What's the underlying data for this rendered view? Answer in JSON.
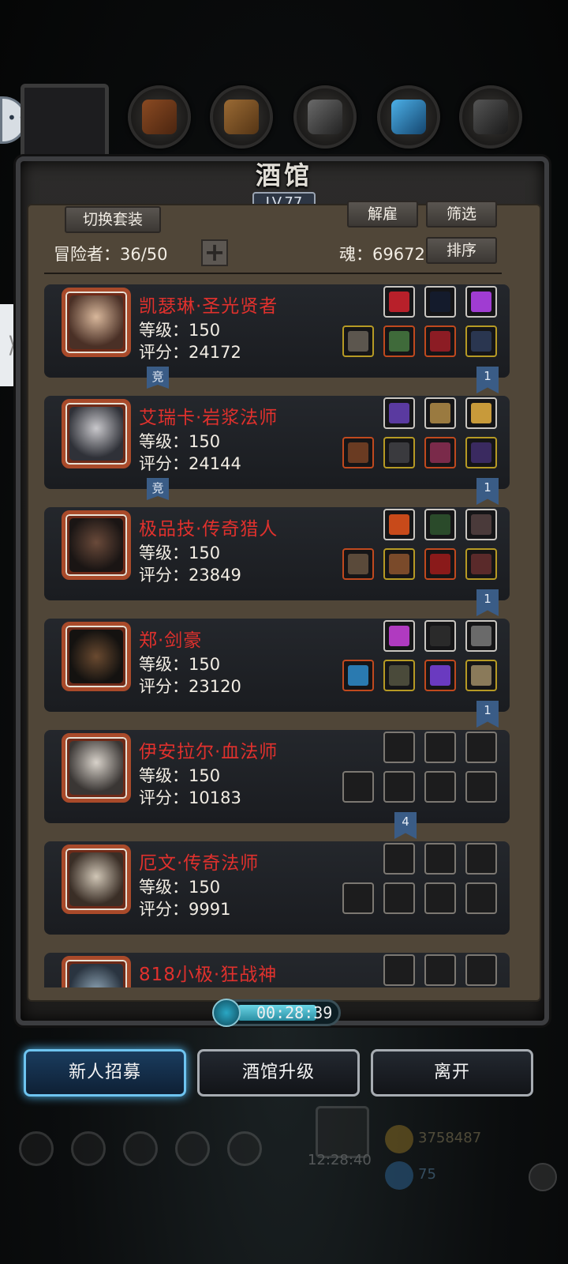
{
  "tavern": {
    "title": "酒馆",
    "level": "LV.77",
    "switch_outfit": "切换套装",
    "dismiss": "解雇",
    "filter": "筛选",
    "sort": "排序",
    "adventurers_label": "冒险者：36/50",
    "soul_label": "魂：69672",
    "plus": "+"
  },
  "heroes": [
    {
      "name": "凯瑟琳·圣光贤者",
      "level": "等级：150",
      "score": "评分：24172",
      "tag": "竞",
      "ribbon": "1"
    },
    {
      "name": "艾瑞卡·岩浆法师",
      "level": "等级：150",
      "score": "评分：24144",
      "tag": "竞",
      "ribbon": "1"
    },
    {
      "name": "极品技·传奇猎人",
      "level": "等级：150",
      "score": "评分：23849",
      "ribbon": "1"
    },
    {
      "name": "郑·剑豪",
      "level": "等级：150",
      "score": "评分：23120",
      "ribbon": "1"
    },
    {
      "name": "伊安拉尔·血法师",
      "level": "等级：150",
      "score": "评分：10183",
      "ribbon": "4"
    },
    {
      "name": "厄文·传奇法师",
      "level": "等级：150",
      "score": "评分：9991"
    },
    {
      "name": "818小极·狂战神"
    }
  ],
  "timer": "00:28:39",
  "buttons": {
    "recruit": "新人招募",
    "upgrade": "酒馆升级",
    "leave": "离开"
  },
  "hud": {
    "gold": "3758487",
    "gems": "75",
    "clock": "12:28:40"
  },
  "colors": {
    "hero_name": "#e0312d",
    "panel_inner": "#504638",
    "active_button_glow": "#4fb3ea",
    "ribbon": "#3a5c86"
  },
  "icons": [
    "chat-bubble-icon",
    "gear-slot-icon",
    "timer-clock-icon",
    "gold-coin-icon",
    "gem-icon",
    "add-circle-icon"
  ]
}
